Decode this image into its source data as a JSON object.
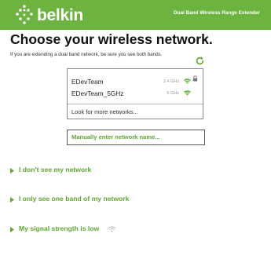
{
  "header": {
    "brand": "belkin",
    "product": "Dual Band Wireless Range Extender"
  },
  "main": {
    "title": "Choose your wireless network.",
    "subtitle": "If you are extending a dual band network, be sure you see both bands.",
    "networks": [
      {
        "name": "EDevTeam",
        "band": "2.4 GHz",
        "icon": "wifi-icon"
      },
      {
        "name": "EDevTeam_5GHz",
        "band": "5 GHz",
        "icon": "wifi-icon"
      }
    ],
    "secured_icon": "lock-icon",
    "refresh_icon": "refresh-icon",
    "look_more": "Look for more networks...",
    "manual_button": "Manually enter network name..."
  },
  "help": {
    "items": [
      {
        "label": "I don't see my network"
      },
      {
        "label": "I only see one band of my network"
      },
      {
        "label": "My signal strength is low",
        "icon": "wifi-signal-icon"
      }
    ]
  },
  "colors": {
    "header_bg": "#6cb33f",
    "accent_green": "#5ea631",
    "wifi_green": "#5fb130",
    "muted_gray": "#999999"
  }
}
